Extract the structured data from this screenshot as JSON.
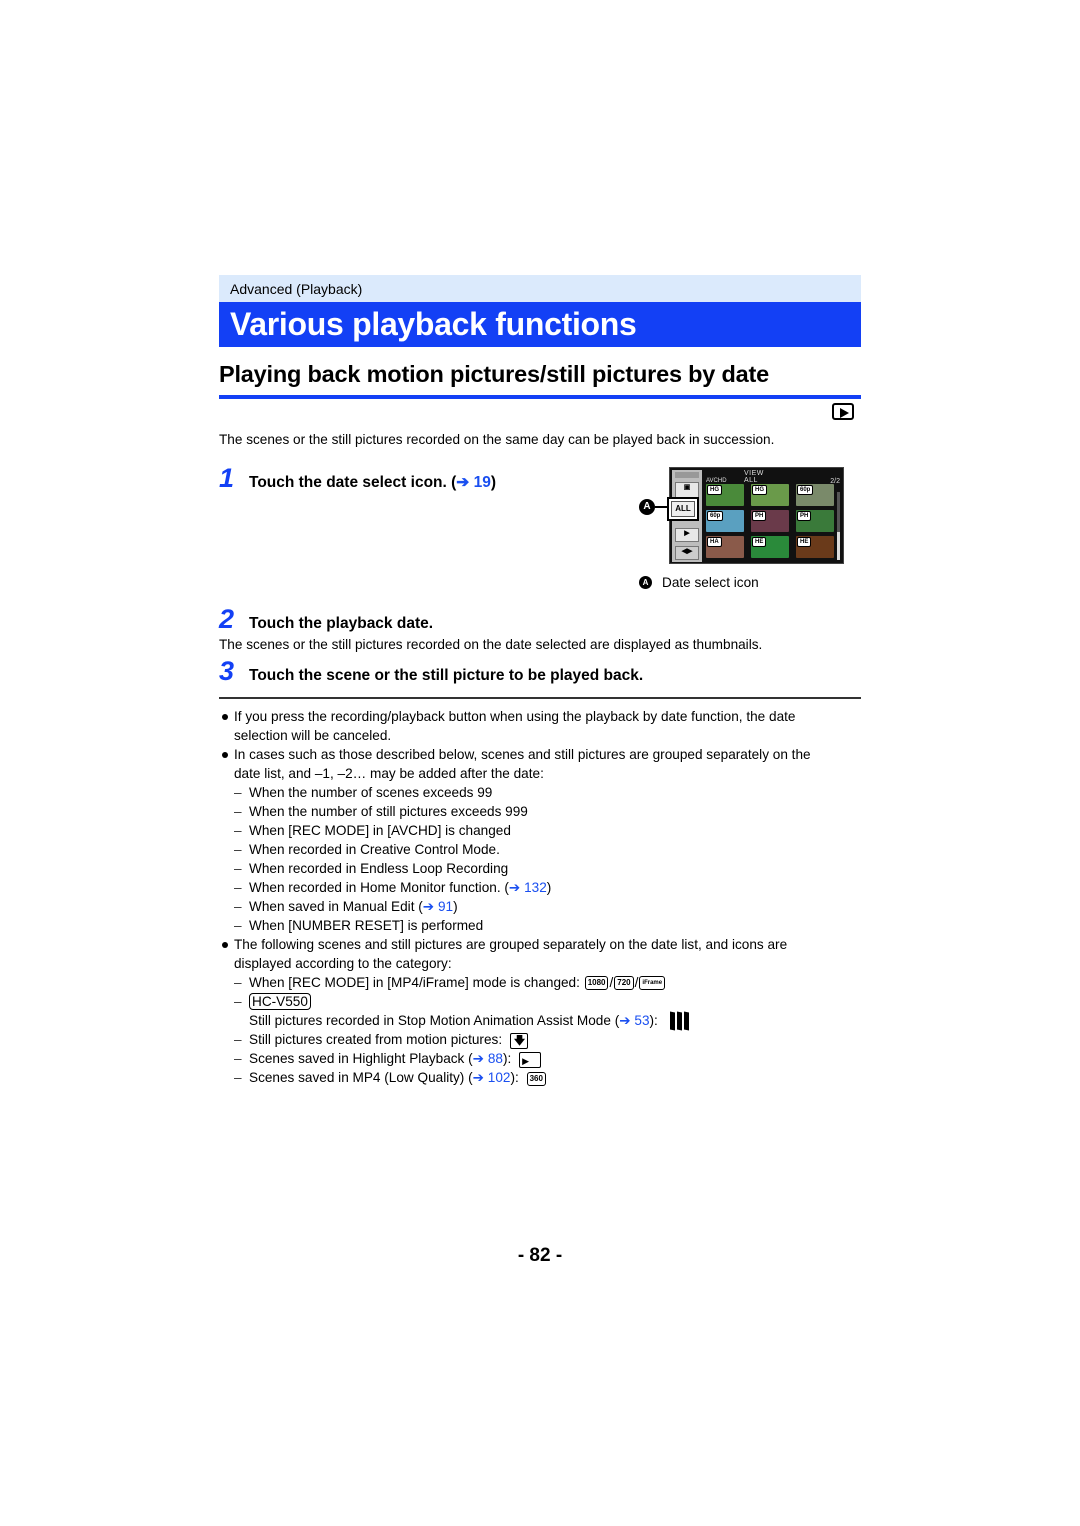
{
  "header": {
    "section": "Advanced (Playback)",
    "title": "Various playback functions",
    "subtitle": "Playing back motion pictures/still pictures by date",
    "mode_icon": "playback-mode-icon"
  },
  "intro": "The scenes or the still pictures recorded on the same day can be played back in succession.",
  "steps": [
    {
      "num": "1",
      "text": "Touch the date select icon. (",
      "link": "➔ 19",
      "after": ")"
    },
    {
      "num": "2",
      "text": "Touch the playback date.",
      "desc": "The scenes or the still pictures recorded on the date selected are displayed as thumbnails."
    },
    {
      "num": "3",
      "text": "Touch the scene or the still picture to be played back."
    }
  ],
  "screen": {
    "label": "A",
    "top_label": "VIEW ALL",
    "format": "AVCHD",
    "page": "2/2",
    "all_button": "ALL",
    "thumbnails": [
      {
        "tag": "HG",
        "color": "#4a8a3a"
      },
      {
        "tag": "HG",
        "color": "#6a9a4a"
      },
      {
        "tag": "60p",
        "color": "#7a8a6a"
      },
      {
        "tag": "60p",
        "color": "#5aa0c0"
      },
      {
        "tag": "PH",
        "color": "#6a3a4a"
      },
      {
        "tag": "PH",
        "color": "#3a7a3a"
      },
      {
        "tag": "HA",
        "color": "#8a5a4a"
      },
      {
        "tag": "HE",
        "color": "#2a8a3a"
      },
      {
        "tag": "HE",
        "color": "#6a3a1a"
      }
    ],
    "caption_label": "A",
    "caption": "Date select icon"
  },
  "notes": {
    "bullet1": "If you press the recording/playback button when using the playback by date function, the date",
    "bullet1_cont": "selection will be canceled.",
    "bullet2": "In cases such as those described below, scenes and still pictures are grouped separately on the",
    "bullet2_cont": "date list, and –1, –2… may be added after the date:",
    "cases": [
      {
        "text": "When the number of scenes exceeds 99"
      },
      {
        "text": "When the number of still pictures exceeds 999"
      },
      {
        "text": "When [REC MODE] in [AVCHD] is changed"
      },
      {
        "text": "When recorded in Creative Control Mode."
      },
      {
        "text": "When recorded in Endless Loop Recording"
      },
      {
        "text": "When recorded in Home Monitor function. (",
        "link": "➔ 132",
        "after": ")"
      },
      {
        "text": "When saved in Manual Edit (",
        "link": "➔ 91",
        "after": ")"
      },
      {
        "text": "When [NUMBER RESET] is performed"
      }
    ],
    "bullet3": "The following scenes and still pictures are grouped separately on the date list, and icons are",
    "bullet3_cont": "displayed according to the category:",
    "categories": {
      "rec_mode": "When [REC MODE] in [MP4/iFrame] mode is changed:",
      "rec_icons": [
        "1080",
        "720",
        "iFrame"
      ],
      "model": "HC-V550",
      "stop_motion": "Still pictures recorded in Stop Motion Animation Assist Mode (",
      "stop_motion_link": "➔ 53",
      "stop_motion_after": "):",
      "from_motion": "Still pictures created from motion pictures:",
      "highlight": "Scenes saved in Highlight Playback (",
      "highlight_link": "➔ 88",
      "highlight_after": "):",
      "mp4_low": "Scenes saved in MP4 (Low Quality) (",
      "mp4_low_link": "➔ 102",
      "mp4_low_after": "):",
      "mp4_low_icon": "360"
    },
    "dash": "–",
    "separator": "/"
  },
  "footer": {
    "page": "- 82 -"
  }
}
